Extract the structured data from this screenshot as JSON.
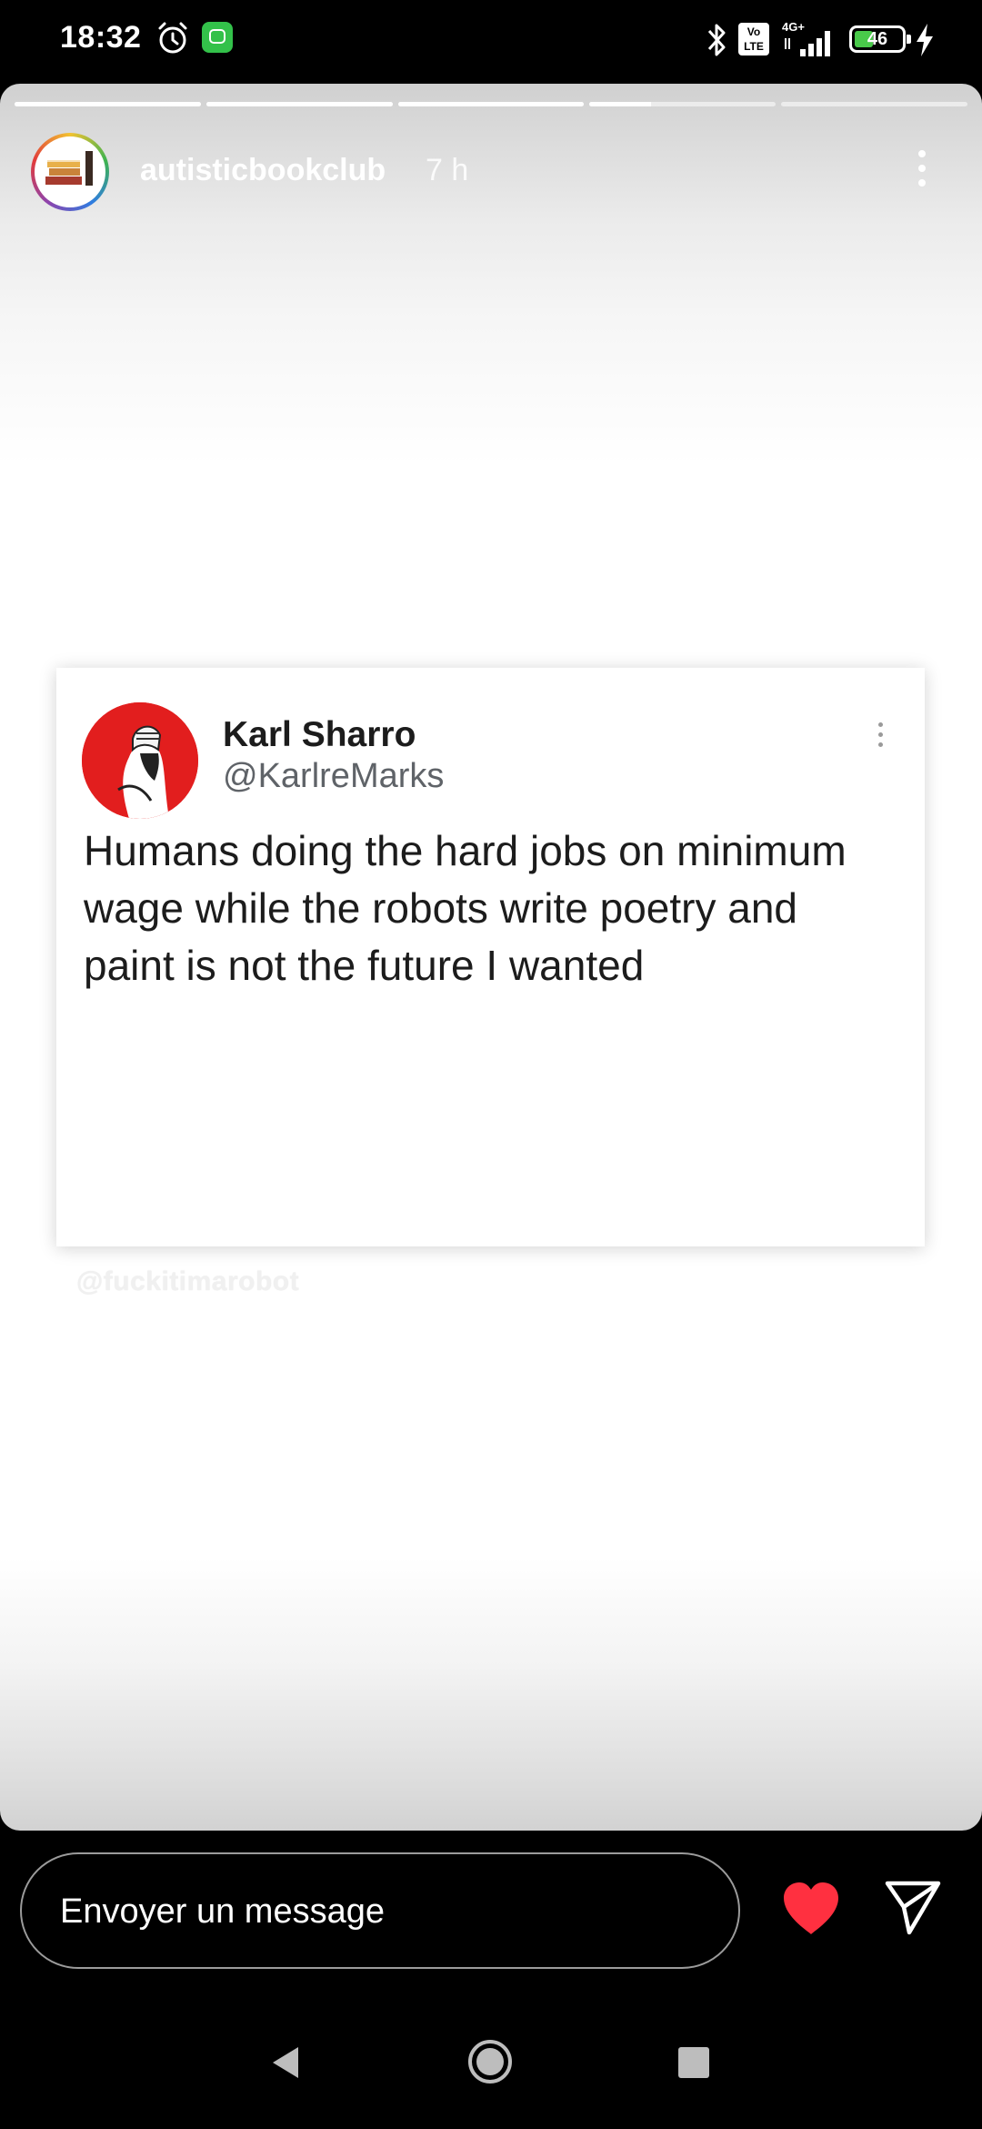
{
  "status_bar": {
    "time": "18:32",
    "network": "4G+",
    "volte": "Vo LTE",
    "battery": "46",
    "battery_fraction": 0.46,
    "icons": [
      "alarm-icon",
      "app-notification-icon",
      "bluetooth-icon",
      "volte-icon",
      "signal-icon",
      "battery-icon",
      "charging-icon"
    ]
  },
  "story": {
    "progress_segments": [
      1,
      1,
      1,
      0.33,
      0
    ],
    "username": "autisticbookclub",
    "time_ago": "7 h",
    "more_icon": "more-vertical-icon",
    "tweet": {
      "author_name": "Karl Sharro",
      "handle": "@KarlreMarks",
      "text": "Humans doing the hard jobs on minimum wage while the robots write poetry and paint is not the future I wanted",
      "avatar_color": "#e21e1e"
    },
    "watermark": "@fuckitimarobot"
  },
  "reply": {
    "placeholder": "Envoyer un message",
    "heart_color": "#ff3040",
    "icons": [
      "heart-icon",
      "send-icon"
    ]
  },
  "nav": {
    "icons": [
      "back-icon",
      "home-icon",
      "recents-icon"
    ]
  }
}
